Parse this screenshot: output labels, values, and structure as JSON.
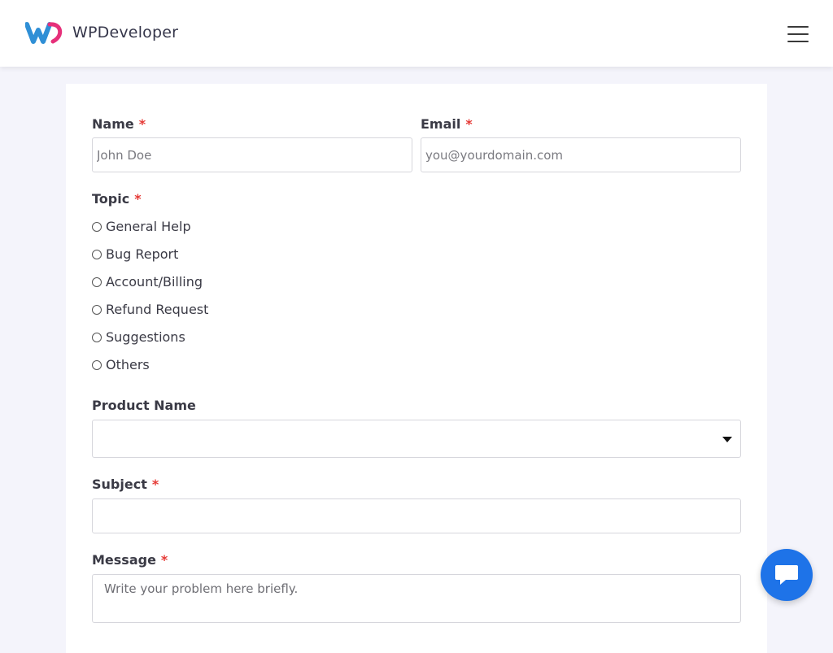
{
  "header": {
    "brand": "WPDeveloper",
    "logo_icon": "wpdeveloper-logo-icon",
    "menu_icon": "hamburger-menu-icon"
  },
  "form": {
    "required_marker": "*",
    "name": {
      "label": "Name",
      "placeholder": "John Doe",
      "value": ""
    },
    "email": {
      "label": "Email",
      "placeholder": "you@yourdomain.com",
      "value": ""
    },
    "topic": {
      "label": "Topic",
      "options": [
        "General Help",
        "Bug Report",
        "Account/Billing",
        "Refund Request",
        "Suggestions",
        "Others"
      ]
    },
    "product": {
      "label": "Product Name",
      "selected": ""
    },
    "subject": {
      "label": "Subject",
      "value": ""
    },
    "message": {
      "label": "Message",
      "placeholder": "Write your problem here briefly."
    }
  },
  "chat": {
    "icon": "chat-bubble-icon"
  },
  "colors": {
    "accent": "#1e73e8",
    "required": "#e53935",
    "page_background": "#f4f4fb",
    "logo_blue": "#2f8fd6",
    "logo_pink": "#e6307a"
  }
}
